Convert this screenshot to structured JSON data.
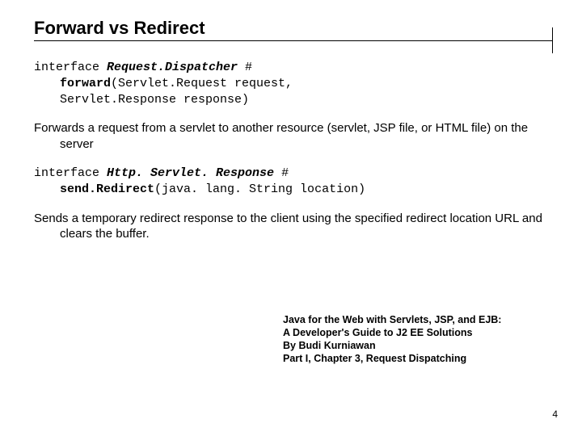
{
  "title": "Forward vs Redirect",
  "sig1": {
    "l1a": "interface ",
    "l1b": "Request.Dispatcher",
    "l1c": " #",
    "l2a": "forward",
    "l2b": "(Servlet.Request request,",
    "l3": "Servlet.Response response)"
  },
  "desc1": "Forwards a request from a servlet to another resource (servlet, JSP file, or HTML file) on the server",
  "sig2": {
    "l1a": "interface ",
    "l1b": "Http. Servlet. Response",
    "l1c": " #",
    "l2a": "send.Redirect",
    "l2b": "(java. lang. String location)"
  },
  "desc2": "Sends a temporary redirect response to the client using the specified redirect location URL and clears the buffer.",
  "ref": {
    "l1": "Java for the Web with Servlets, JSP, and EJB:",
    "l2": "A Developer's Guide to J2 EE Solutions",
    "l3": "By Budi Kurniawan",
    "l4": "Part I, Chapter 3, Request Dispatching"
  },
  "page": "4"
}
